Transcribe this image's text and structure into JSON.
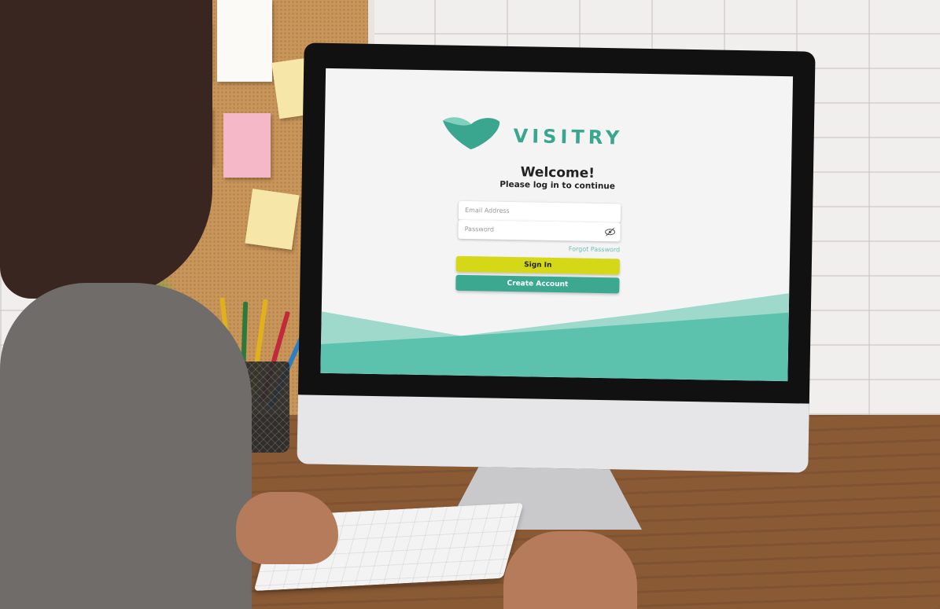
{
  "app": {
    "brand": "VISITRY",
    "colors": {
      "accent": "#3aa68f",
      "signin": "#d5d816",
      "wave": "#5cc2ae"
    }
  },
  "login": {
    "title": "Welcome!",
    "subtitle": "Please log in to continue",
    "email_placeholder": "Email Address",
    "password_placeholder": "Password",
    "forgot_label": "Forgot Password",
    "signin_label": "Sign In",
    "create_label": "Create Account"
  },
  "icons": {
    "password_toggle": "eye-slash-icon",
    "logo": "heart-logo-icon"
  }
}
